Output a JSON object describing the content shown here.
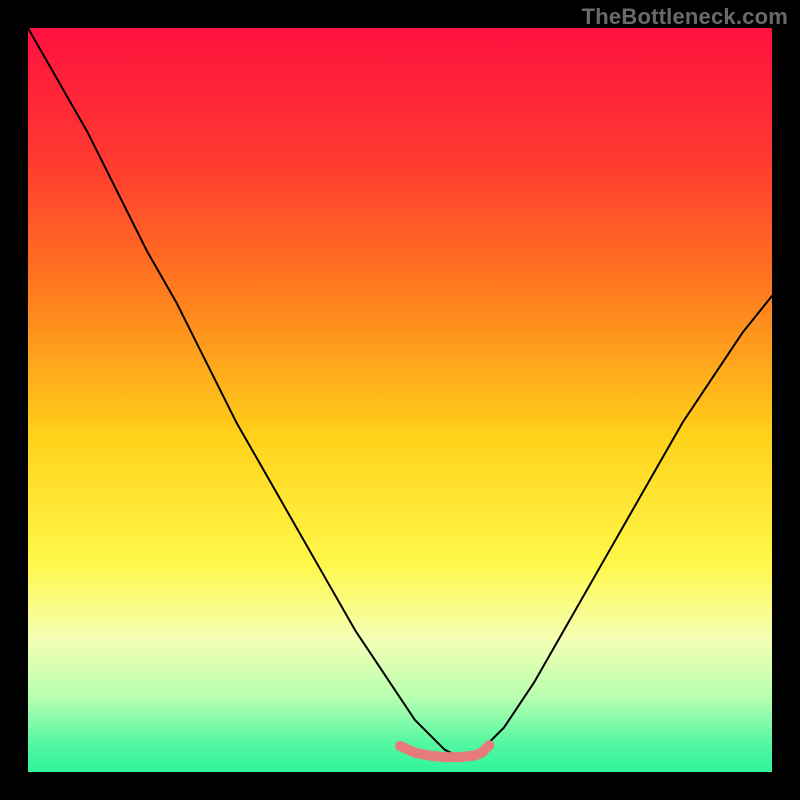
{
  "watermark": "TheBottleneck.com",
  "chart_data": {
    "type": "line",
    "title": "",
    "xlabel": "",
    "ylabel": "",
    "x_range": [
      0,
      100
    ],
    "y_range": [
      0,
      100
    ],
    "grid": false,
    "legend": false,
    "gradient_stops": [
      {
        "offset": 0.0,
        "color": "#ff113f"
      },
      {
        "offset": 0.18,
        "color": "#ff3a30"
      },
      {
        "offset": 0.35,
        "color": "#ff7a1e"
      },
      {
        "offset": 0.55,
        "color": "#ffd21a"
      },
      {
        "offset": 0.72,
        "color": "#fff84a"
      },
      {
        "offset": 0.82,
        "color": "#f5ffb4"
      },
      {
        "offset": 0.9,
        "color": "#b8ffb0"
      },
      {
        "offset": 0.96,
        "color": "#56f7a3"
      },
      {
        "offset": 1.0,
        "color": "#2ef59b"
      }
    ],
    "series": [
      {
        "name": "bottleneck-curve",
        "color": "#000000",
        "width": 2,
        "x": [
          0,
          4,
          8,
          12,
          16,
          20,
          24,
          28,
          32,
          36,
          40,
          44,
          48,
          52,
          56,
          58,
          60,
          64,
          68,
          72,
          76,
          80,
          84,
          88,
          92,
          96,
          100
        ],
        "y": [
          100,
          93,
          86,
          78,
          70,
          63,
          55,
          47,
          40,
          33,
          26,
          19,
          13,
          7,
          3,
          2,
          2,
          6,
          12,
          19,
          26,
          33,
          40,
          47,
          53,
          59,
          64
        ]
      },
      {
        "name": "optimal-flat",
        "color": "#e77b7b",
        "width": 10,
        "x": [
          50,
          52,
          54,
          55,
          56,
          58,
          60,
          61,
          62
        ],
        "y": [
          3.5,
          2.6,
          2.2,
          2.1,
          2.0,
          2.0,
          2.2,
          2.6,
          3.6
        ]
      }
    ]
  }
}
